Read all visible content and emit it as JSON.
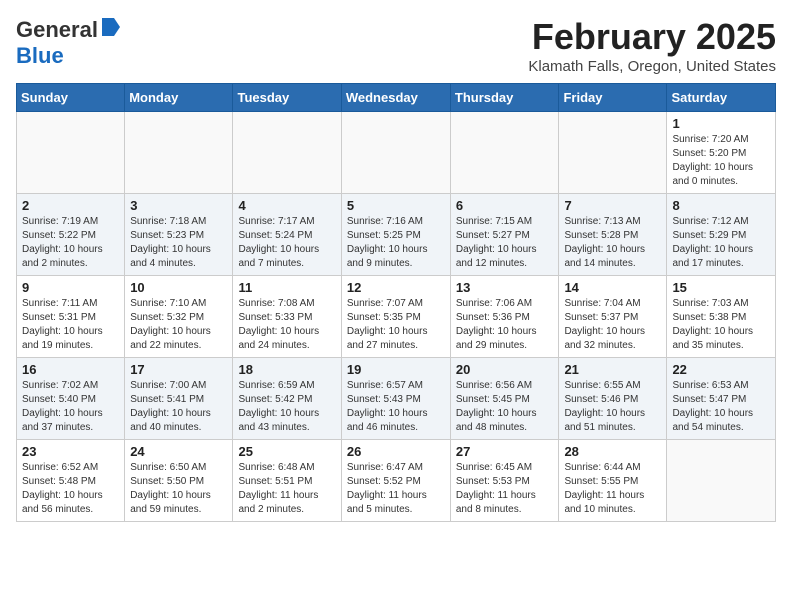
{
  "header": {
    "logo_general": "General",
    "logo_blue": "Blue",
    "month_title": "February 2025",
    "location": "Klamath Falls, Oregon, United States"
  },
  "days_of_week": [
    "Sunday",
    "Monday",
    "Tuesday",
    "Wednesday",
    "Thursday",
    "Friday",
    "Saturday"
  ],
  "weeks": [
    {
      "alt": false,
      "days": [
        {
          "num": "",
          "info": ""
        },
        {
          "num": "",
          "info": ""
        },
        {
          "num": "",
          "info": ""
        },
        {
          "num": "",
          "info": ""
        },
        {
          "num": "",
          "info": ""
        },
        {
          "num": "",
          "info": ""
        },
        {
          "num": "1",
          "info": "Sunrise: 7:20 AM\nSunset: 5:20 PM\nDaylight: 10 hours\nand 0 minutes."
        }
      ]
    },
    {
      "alt": true,
      "days": [
        {
          "num": "2",
          "info": "Sunrise: 7:19 AM\nSunset: 5:22 PM\nDaylight: 10 hours\nand 2 minutes."
        },
        {
          "num": "3",
          "info": "Sunrise: 7:18 AM\nSunset: 5:23 PM\nDaylight: 10 hours\nand 4 minutes."
        },
        {
          "num": "4",
          "info": "Sunrise: 7:17 AM\nSunset: 5:24 PM\nDaylight: 10 hours\nand 7 minutes."
        },
        {
          "num": "5",
          "info": "Sunrise: 7:16 AM\nSunset: 5:25 PM\nDaylight: 10 hours\nand 9 minutes."
        },
        {
          "num": "6",
          "info": "Sunrise: 7:15 AM\nSunset: 5:27 PM\nDaylight: 10 hours\nand 12 minutes."
        },
        {
          "num": "7",
          "info": "Sunrise: 7:13 AM\nSunset: 5:28 PM\nDaylight: 10 hours\nand 14 minutes."
        },
        {
          "num": "8",
          "info": "Sunrise: 7:12 AM\nSunset: 5:29 PM\nDaylight: 10 hours\nand 17 minutes."
        }
      ]
    },
    {
      "alt": false,
      "days": [
        {
          "num": "9",
          "info": "Sunrise: 7:11 AM\nSunset: 5:31 PM\nDaylight: 10 hours\nand 19 minutes."
        },
        {
          "num": "10",
          "info": "Sunrise: 7:10 AM\nSunset: 5:32 PM\nDaylight: 10 hours\nand 22 minutes."
        },
        {
          "num": "11",
          "info": "Sunrise: 7:08 AM\nSunset: 5:33 PM\nDaylight: 10 hours\nand 24 minutes."
        },
        {
          "num": "12",
          "info": "Sunrise: 7:07 AM\nSunset: 5:35 PM\nDaylight: 10 hours\nand 27 minutes."
        },
        {
          "num": "13",
          "info": "Sunrise: 7:06 AM\nSunset: 5:36 PM\nDaylight: 10 hours\nand 29 minutes."
        },
        {
          "num": "14",
          "info": "Sunrise: 7:04 AM\nSunset: 5:37 PM\nDaylight: 10 hours\nand 32 minutes."
        },
        {
          "num": "15",
          "info": "Sunrise: 7:03 AM\nSunset: 5:38 PM\nDaylight: 10 hours\nand 35 minutes."
        }
      ]
    },
    {
      "alt": true,
      "days": [
        {
          "num": "16",
          "info": "Sunrise: 7:02 AM\nSunset: 5:40 PM\nDaylight: 10 hours\nand 37 minutes."
        },
        {
          "num": "17",
          "info": "Sunrise: 7:00 AM\nSunset: 5:41 PM\nDaylight: 10 hours\nand 40 minutes."
        },
        {
          "num": "18",
          "info": "Sunrise: 6:59 AM\nSunset: 5:42 PM\nDaylight: 10 hours\nand 43 minutes."
        },
        {
          "num": "19",
          "info": "Sunrise: 6:57 AM\nSunset: 5:43 PM\nDaylight: 10 hours\nand 46 minutes."
        },
        {
          "num": "20",
          "info": "Sunrise: 6:56 AM\nSunset: 5:45 PM\nDaylight: 10 hours\nand 48 minutes."
        },
        {
          "num": "21",
          "info": "Sunrise: 6:55 AM\nSunset: 5:46 PM\nDaylight: 10 hours\nand 51 minutes."
        },
        {
          "num": "22",
          "info": "Sunrise: 6:53 AM\nSunset: 5:47 PM\nDaylight: 10 hours\nand 54 minutes."
        }
      ]
    },
    {
      "alt": false,
      "days": [
        {
          "num": "23",
          "info": "Sunrise: 6:52 AM\nSunset: 5:48 PM\nDaylight: 10 hours\nand 56 minutes."
        },
        {
          "num": "24",
          "info": "Sunrise: 6:50 AM\nSunset: 5:50 PM\nDaylight: 10 hours\nand 59 minutes."
        },
        {
          "num": "25",
          "info": "Sunrise: 6:48 AM\nSunset: 5:51 PM\nDaylight: 11 hours\nand 2 minutes."
        },
        {
          "num": "26",
          "info": "Sunrise: 6:47 AM\nSunset: 5:52 PM\nDaylight: 11 hours\nand 5 minutes."
        },
        {
          "num": "27",
          "info": "Sunrise: 6:45 AM\nSunset: 5:53 PM\nDaylight: 11 hours\nand 8 minutes."
        },
        {
          "num": "28",
          "info": "Sunrise: 6:44 AM\nSunset: 5:55 PM\nDaylight: 11 hours\nand 10 minutes."
        },
        {
          "num": "",
          "info": ""
        }
      ]
    }
  ]
}
